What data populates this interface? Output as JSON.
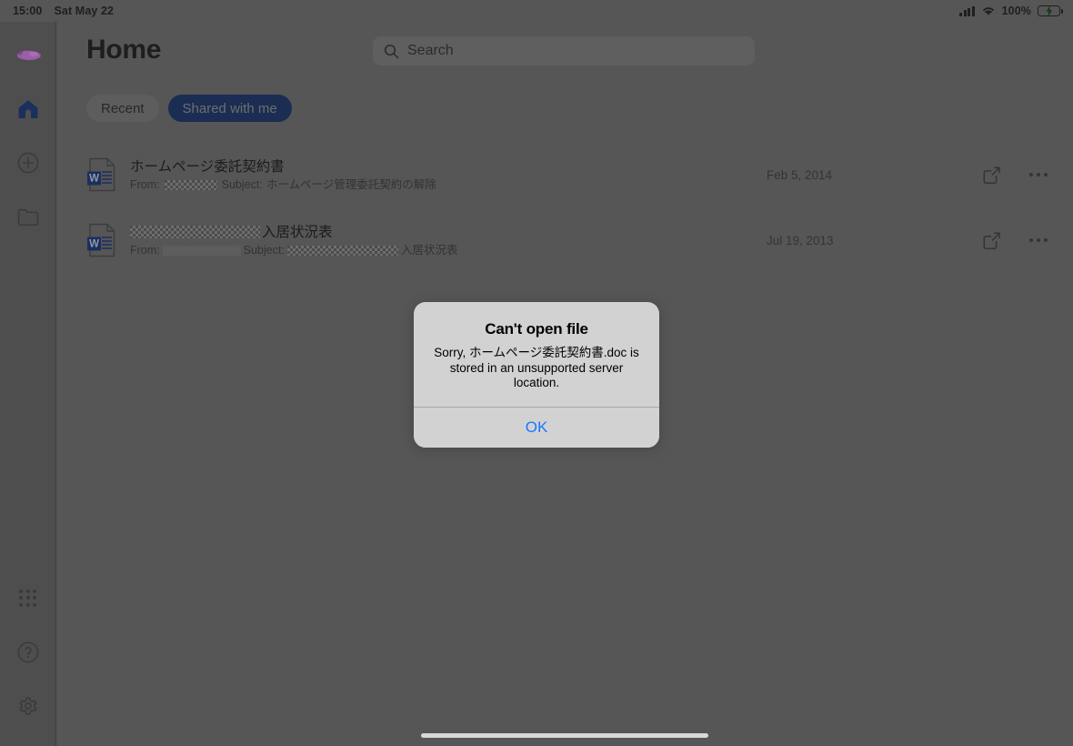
{
  "status_bar": {
    "time": "15:00",
    "date": "Sat May 22",
    "battery_percent": "100%",
    "signal_icon": "cellular-bars-icon",
    "wifi_icon": "wifi-icon",
    "battery_icon": "battery-charging-icon"
  },
  "sidebar": {
    "logo_name": "app-logo",
    "top_items": [
      {
        "name": "sidebar-item-home",
        "icon": "home-icon",
        "active": true
      },
      {
        "name": "sidebar-item-new",
        "icon": "plus-circle-icon",
        "active": false
      },
      {
        "name": "sidebar-item-files",
        "icon": "folder-icon",
        "active": false
      }
    ],
    "bottom_items": [
      {
        "name": "sidebar-item-apps",
        "icon": "apps-grid-icon"
      },
      {
        "name": "sidebar-item-help",
        "icon": "question-circle-icon"
      },
      {
        "name": "sidebar-item-settings",
        "icon": "gear-icon"
      }
    ]
  },
  "header": {
    "title": "Home"
  },
  "search": {
    "placeholder": "Search",
    "value": "",
    "icon": "search-icon"
  },
  "tabs": [
    {
      "label": "Recent",
      "selected": false
    },
    {
      "label": "Shared with me",
      "selected": true
    }
  ],
  "files": [
    {
      "title_prefix": "",
      "title": "ホームページ委託契約書",
      "title_redacted": false,
      "sub_from_label": "From:",
      "sub_from_value": "",
      "sub_from_redacted": true,
      "sub_subject_label": "Subject:",
      "sub_subject_value": "ホームページ管理委託契約の解除",
      "sub_subject_redacted": false,
      "date": "Feb 5, 2014",
      "file_type_icon": "word-document-icon",
      "share_icon": "share-icon",
      "more_icon": "more-options-icon"
    },
    {
      "title_prefix": "",
      "title": "入居状況表",
      "title_redacted": true,
      "sub_from_label": "From:",
      "sub_from_value": "",
      "sub_from_redacted": true,
      "sub_subject_label": "Subject:",
      "sub_subject_value": "入居状況表",
      "sub_subject_redacted": true,
      "date": "Jul 19, 2013",
      "file_type_icon": "word-document-icon",
      "share_icon": "share-icon",
      "more_icon": "more-options-icon"
    }
  ],
  "alert": {
    "title": "Can't open file",
    "message": "Sorry, ホームページ委託契約書.doc is stored in an unsupported server location.",
    "ok_label": "OK"
  },
  "colors": {
    "accent_blue": "#1878ff",
    "chip_active_bg": "#1b2d52",
    "word_icon_blue": "#1b2f5e",
    "battery_green": "#43d15b",
    "logo_purple": "#9b5fa8",
    "scrim": "rgba(0,0,0,0.45)"
  },
  "home_indicator": "home-indicator"
}
